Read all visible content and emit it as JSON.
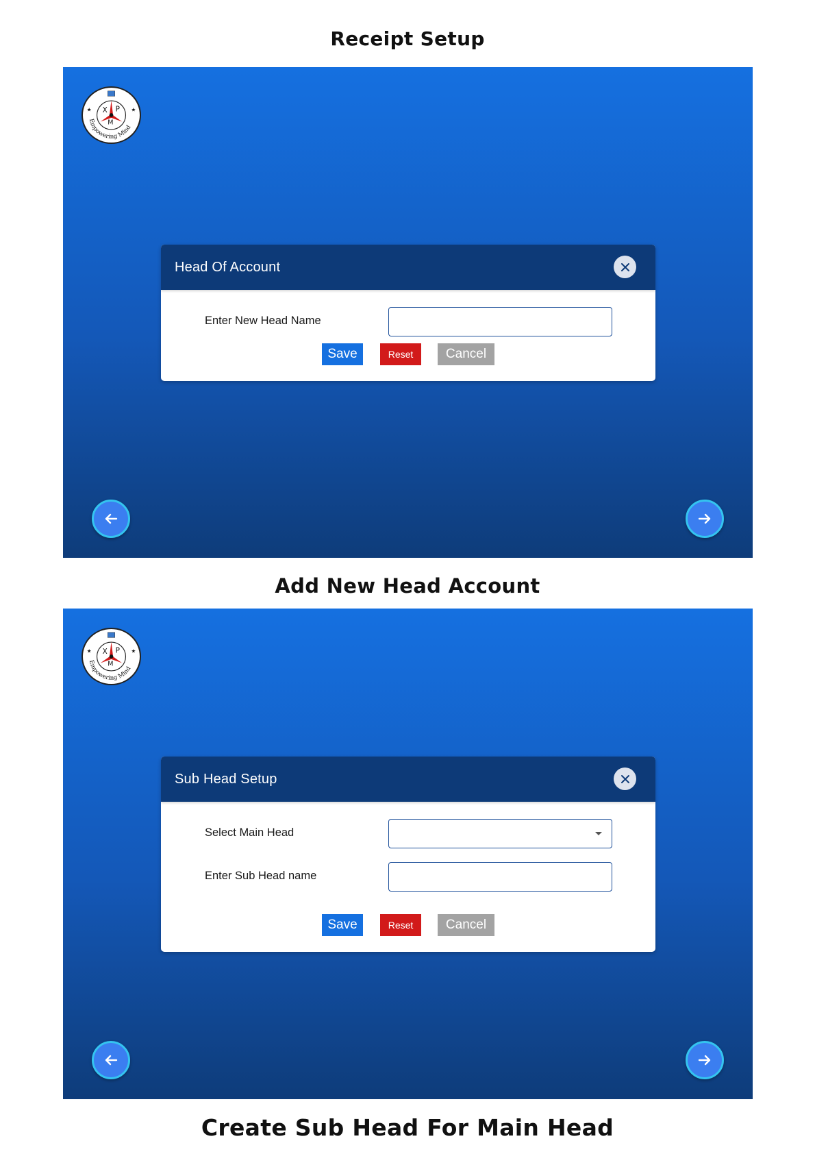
{
  "captions": {
    "top": "Receipt Setup",
    "middle": "Add New Head Account",
    "bottom": "Create Sub Head For Main Head"
  },
  "logo": {
    "letters": [
      "X",
      "P",
      "M"
    ],
    "tagline": "Empowering Mind"
  },
  "screens": [
    {
      "dialog": {
        "title": "Head Of Account",
        "close_icon": "close-icon",
        "fields": [
          {
            "label": "Enter New Head Name",
            "type": "text",
            "value": ""
          }
        ],
        "buttons": {
          "save": "Save",
          "reset": "Reset",
          "cancel": "Cancel"
        }
      },
      "nav": {
        "prev_icon": "arrow-left-icon",
        "next_icon": "arrow-right-icon"
      }
    },
    {
      "dialog": {
        "title": "Sub Head Setup",
        "close_icon": "close-icon",
        "fields": [
          {
            "label": "Select Main Head",
            "type": "select",
            "value": ""
          },
          {
            "label": "Enter Sub Head name",
            "type": "text",
            "value": ""
          }
        ],
        "buttons": {
          "save": "Save",
          "reset": "Reset",
          "cancel": "Cancel"
        }
      },
      "nav": {
        "prev_icon": "arrow-left-icon",
        "next_icon": "arrow-right-icon"
      }
    }
  ],
  "colors": {
    "panel_gradient_top": "#1570e0",
    "panel_gradient_bottom": "#0e3c7a",
    "dialog_header": "#0d3a78",
    "save_button": "#1570e0",
    "reset_button": "#d21a1a",
    "cancel_button": "#a3a3a3",
    "nav_button": "#3b7ef0",
    "nav_ring": "#34c4f0"
  }
}
